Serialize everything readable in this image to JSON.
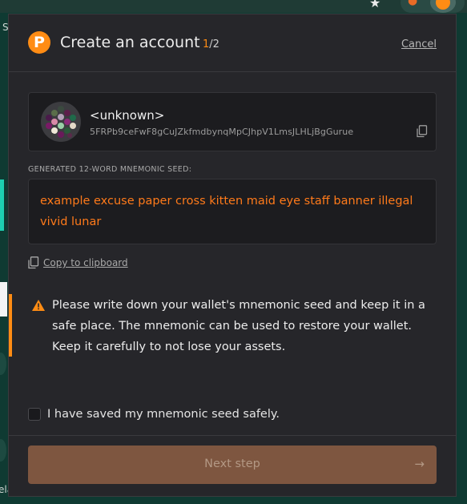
{
  "background": {
    "side_letter": "S",
    "side_text": "ela"
  },
  "header": {
    "title": "Create an account",
    "step_current": "1",
    "step_total": "/2",
    "cancel_label": "Cancel"
  },
  "account": {
    "name": "<unknown>",
    "address": "5FRPb9ceFwF8gCuJZkfmdbynqMpCJhpV1LmsJLHLjBgGurue"
  },
  "seed": {
    "label": "GENERATED 12-WORD MNEMONIC SEED:",
    "phrase": "example excuse paper cross kitten maid eye staff banner illegal vivid lunar",
    "copy_label": "Copy to clipboard"
  },
  "warning": {
    "text": "Please write down your wallet's mnemonic seed and keep it in a safe place. The mnemonic can be used to restore your wallet. Keep it carefully to not lose your assets."
  },
  "confirm": {
    "checkbox_label": "I have saved my mnemonic seed safely.",
    "checked": false
  },
  "footer": {
    "next_label": "Next step",
    "next_arrow": "→"
  },
  "colors": {
    "accent": "#ff8c14",
    "seed_text": "#ff7a1a",
    "popup_bg": "#26262a",
    "page_bg": "#0f3a32"
  },
  "icons": [
    "star-icon",
    "fox-extension-icon",
    "polkadot-logo-icon",
    "identicon",
    "copy-icon",
    "clipboard-icon",
    "warning-icon",
    "arrow-right-icon"
  ]
}
